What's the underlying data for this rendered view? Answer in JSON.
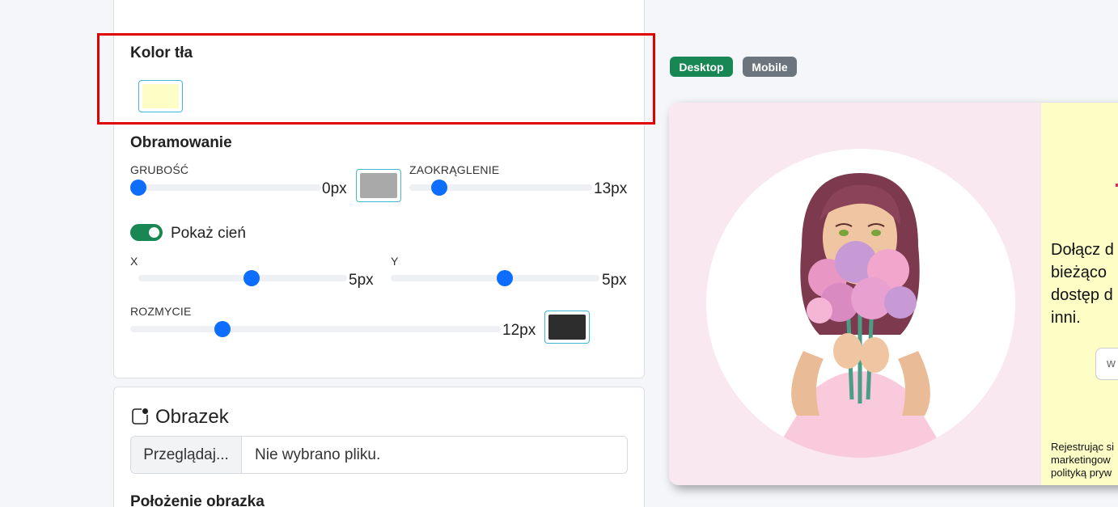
{
  "background_section": {
    "title": "Kolor tła",
    "color": "#fdfdc6"
  },
  "border_section": {
    "title": "Obramowanie",
    "thickness_label": "GRUBOŚĆ",
    "thickness_value": "0px",
    "thickness_level": 0,
    "border_color": "#a9a9a9",
    "rounding_label": "ZAOKRĄGLENIE",
    "rounding_value": "13px"
  },
  "shadow_section": {
    "toggle_label": "Pokaż cień",
    "toggle_on": true,
    "x_label": "X",
    "x_value": "5px",
    "y_label": "Y",
    "y_value": "5px",
    "blur_label": "ROZMYCIE",
    "blur_value": "12px",
    "shadow_color": "#2d2d2d"
  },
  "image_section": {
    "title": "Obrazek",
    "browse_label": "Przeglądaj...",
    "no_file_text": "Nie wybrano pliku.",
    "position_title": "Położenie obrazka"
  },
  "view_badges": {
    "desktop": "Desktop",
    "mobile": "Mobile"
  },
  "preview": {
    "main_text": "Dołącz d\nbieżąco\ndostęp d\ninni.",
    "input_text": "w",
    "footer_text": "Rejestrując si\nmarketingow\npolityką pryw"
  }
}
